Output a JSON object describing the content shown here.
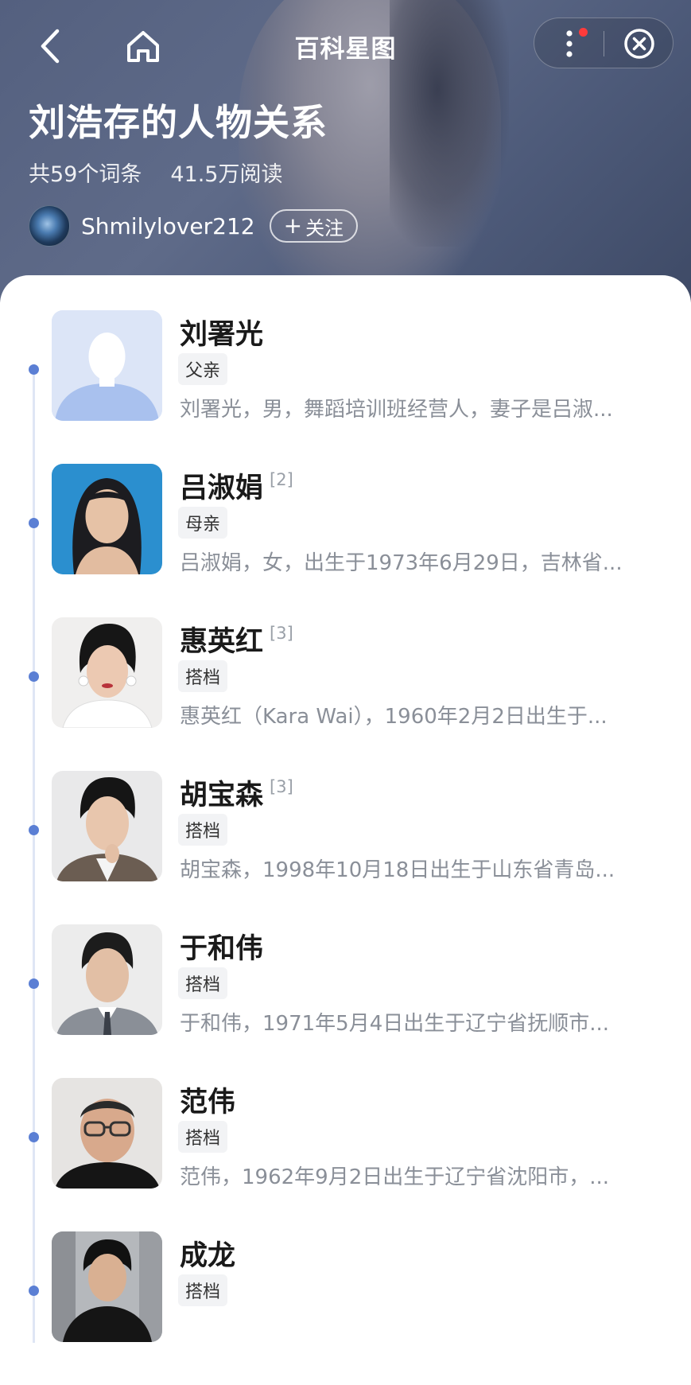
{
  "header": {
    "title": "百科星图",
    "page_title": "刘浩存的人物关系",
    "entries": "共59个词条",
    "reads": "41.5万阅读",
    "author": "Shmilylover212",
    "follow_label": "关注",
    "follow_plus": "+"
  },
  "icons": {
    "back": "chevron-left-icon",
    "home": "home-icon",
    "more": "vertical-dots-icon",
    "close": "close-circle-icon"
  },
  "colors": {
    "accent": "#5b7fd4",
    "notification": "#ff3b3b"
  },
  "relations": [
    {
      "name": "刘署光",
      "ref": "",
      "tag": "父亲",
      "desc": "刘署光，男，舞蹈培训班经营人，妻子是吕淑..."
    },
    {
      "name": "吕淑娟",
      "ref": "[2]",
      "tag": "母亲",
      "desc": "吕淑娟，女，出生于1973年6月29日，吉林省..."
    },
    {
      "name": "惠英红",
      "ref": "[3]",
      "tag": "搭档",
      "desc": "惠英红（Kara Wai），1960年2月2日出生于..."
    },
    {
      "name": "胡宝森",
      "ref": "[3]",
      "tag": "搭档",
      "desc": "胡宝森，1998年10月18日出生于山东省青岛..."
    },
    {
      "name": "于和伟",
      "ref": "",
      "tag": "搭档",
      "desc": "于和伟，1971年5月4日出生于辽宁省抚顺市..."
    },
    {
      "name": "范伟",
      "ref": "",
      "tag": "搭档",
      "desc": "范伟，1962年9月2日出生于辽宁省沈阳市，..."
    },
    {
      "name": "成龙",
      "ref": "",
      "tag": "搭档",
      "desc": ""
    }
  ]
}
